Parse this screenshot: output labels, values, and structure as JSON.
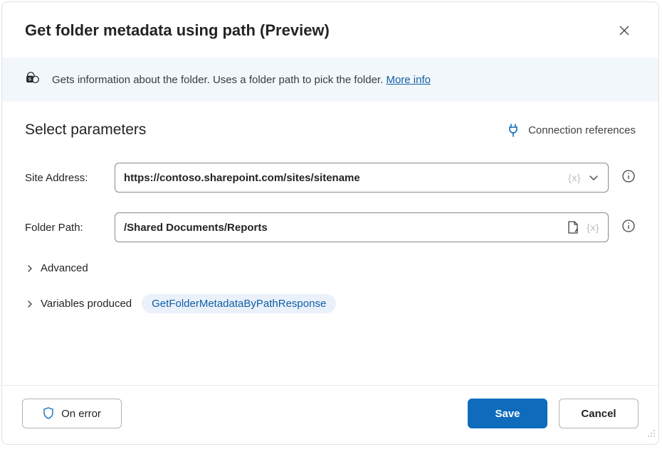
{
  "dialog": {
    "title": "Get folder metadata using path (Preview)",
    "description": "Gets information about the folder. Uses a folder path to pick the folder.",
    "more_info_label": "More info"
  },
  "section": {
    "title": "Select parameters",
    "connection_refs_label": "Connection references"
  },
  "params": {
    "site": {
      "label": "Site Address:",
      "value": "https://contoso.sharepoint.com/sites/sitename",
      "fx_token": "{x}"
    },
    "folder": {
      "label": "Folder Path:",
      "value": "/Shared Documents/Reports",
      "fx_token": "{x}"
    }
  },
  "expanders": {
    "advanced_label": "Advanced",
    "variables_label": "Variables produced",
    "variable_pill": "GetFolderMetadataByPathResponse"
  },
  "footer": {
    "on_error_label": "On error",
    "save_label": "Save",
    "cancel_label": "Cancel"
  }
}
